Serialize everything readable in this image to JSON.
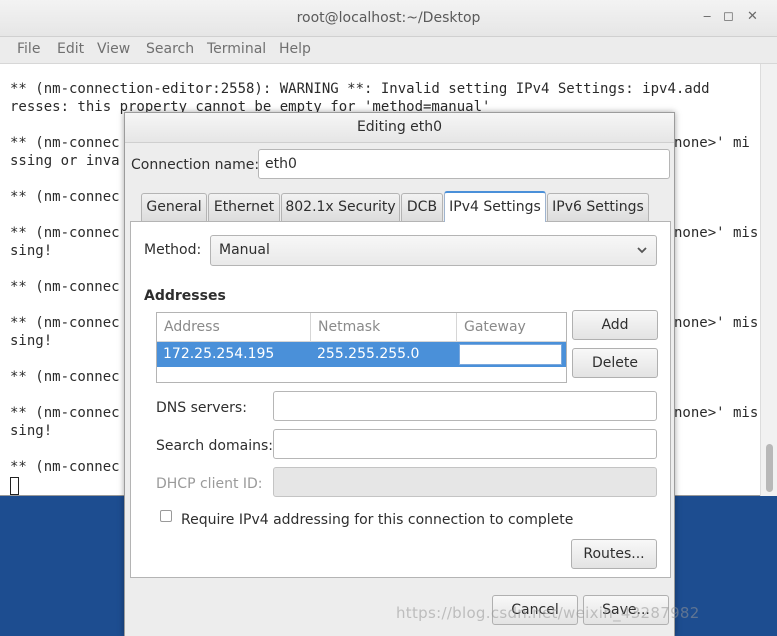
{
  "terminal": {
    "title": "root@localhost:~/Desktop",
    "menu": [
      "File",
      "Edit",
      "View",
      "Search",
      "Terminal",
      "Help"
    ],
    "lines": [
      "** (nm-connection-editor:2558): WARNING **: Invalid setting IPv4 Settings: ipv4.add",
      "resses: this property cannot be empty for 'method=manual'",
      "** (nm-connec",
      "ssing or inva",
      "** (nm-connec",
      "** (nm-connec",
      "sing!",
      "** (nm-connec",
      "** (nm-connec",
      "sing!",
      "** (nm-connec",
      "** (nm-connec",
      "sing!",
      "** (nm-connec"
    ],
    "right_fragments": [
      "none>' mi",
      "none>' mis",
      "none>' mis",
      "none>' mis"
    ]
  },
  "dialog": {
    "title": "Editing eth0",
    "connection_name_label": "Connection name:",
    "connection_name_value": "eth0",
    "tabs": [
      "General",
      "Ethernet",
      "802.1x Security",
      "DCB",
      "IPv4 Settings",
      "IPv6 Settings"
    ],
    "active_tab": "IPv4 Settings",
    "method_label": "Method:",
    "method_value": "Manual",
    "addresses_heading": "Addresses",
    "columns": [
      "Address",
      "Netmask",
      "Gateway"
    ],
    "rows": [
      {
        "address": "172.25.254.195",
        "netmask": "255.255.255.0",
        "gateway": ""
      }
    ],
    "add_button": "Add",
    "delete_button": "Delete",
    "dns_label": "DNS servers:",
    "search_label": "Search domains:",
    "dhcp_label": "DHCP client ID:",
    "require_checkbox_label": "Require IPv4 addressing for this connection to complete",
    "routes_button": "Routes...",
    "cancel_button": "Cancel",
    "save_button": "Save..."
  },
  "watermark": "https://blog.csdn.net/weixin_43287982",
  "colors": {
    "desktop": "#1d4d90",
    "selection": "#4a90d9",
    "active_tab_accent": "#4a90d9"
  }
}
